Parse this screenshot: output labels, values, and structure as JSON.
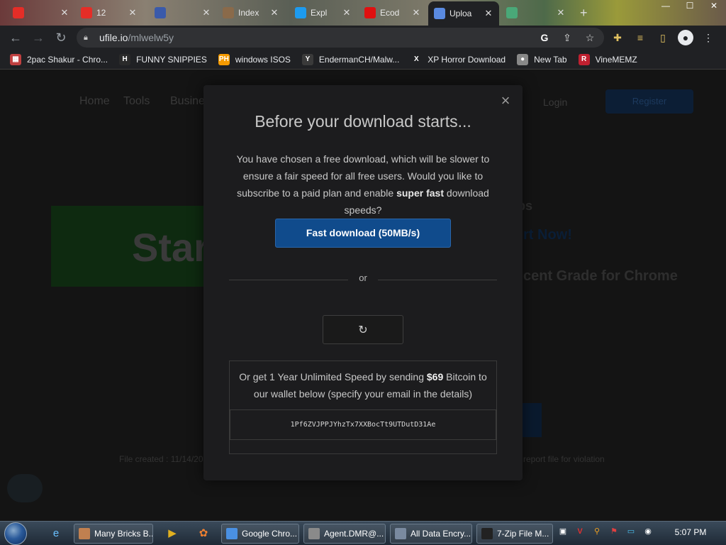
{
  "tabs": [
    {
      "title": "",
      "fav_color": "#e52d27",
      "active": false
    },
    {
      "title": "12",
      "fav_color": "#e52d27",
      "active": false
    },
    {
      "title": "",
      "fav_color": "#3a5aaa",
      "active": false
    },
    {
      "title": "Index",
      "fav_color": "#8a6a4a",
      "active": false
    },
    {
      "title": "Expl",
      "fav_color": "#1d9bf0",
      "active": false
    },
    {
      "title": "Ecod",
      "fav_color": "#e01010",
      "active": false
    },
    {
      "title": "Uploa",
      "fav_color": "#5a8ae0",
      "active": true
    },
    {
      "title": "",
      "fav_color": "#4aa878",
      "active": false
    }
  ],
  "window_controls": {
    "minimize": "—",
    "maximize": "☐",
    "close": "✕"
  },
  "address_bar": {
    "host": "ufile.io",
    "path": "/mlwelw5y"
  },
  "bookmarks": [
    {
      "label": "2pac Shakur - Chro...",
      "icon": "gift-icon",
      "icon_text": "▦",
      "color": "#c04040"
    },
    {
      "label": "FUNNY SNIPPIES",
      "icon": "h-icon",
      "icon_text": "H",
      "color": "#2a2a2a"
    },
    {
      "label": "windows ISOS",
      "icon": "ph-icon",
      "icon_text": "PH",
      "color": "#f59a00"
    },
    {
      "label": "EndermanCH/Malw...",
      "icon": "yp-icon",
      "icon_text": "Y",
      "color": "#3a3a3a"
    },
    {
      "label": "XP Horror Download",
      "icon": "x-icon",
      "icon_text": "X",
      "color": "#202124"
    },
    {
      "label": "New Tab",
      "icon": "ball-icon",
      "icon_text": "●",
      "color": "#888"
    },
    {
      "label": "VineMEMZ",
      "icon": "r-icon",
      "icon_text": "R",
      "color": "#c02030"
    }
  ],
  "page_bg": {
    "nav": [
      "Home",
      "Tools",
      "Business"
    ],
    "login": "Login",
    "register": "Register",
    "start_text": "Star",
    "right_text_1": "ps",
    "right_text_2": "rt Now!",
    "right_text_3": "cent Grade for Chrome",
    "footer_left": "File created : 11/14/20",
    "footer_right": "report file for violation"
  },
  "modal": {
    "close": "×",
    "title": "Before your download starts...",
    "desc_part1": "You have chosen a free download, which will be slower to ensure a fair speed for all free users. Would you like to subscribe to a paid plan and enable ",
    "desc_bold": "super fast",
    "desc_part2": " download speeds?",
    "fast_button": "Fast download (50MB/s)",
    "or": "or",
    "refresh_icon": "↻",
    "btc_part1": "Or get 1 Year Unlimited Speed by sending ",
    "btc_price": "$69",
    "btc_part2": " Bitcoin to our wallet below (specify your email in the details)",
    "wallet": "1Pf6ZVJPPJYhzTx7XXBocTt9UTDutD31Ae"
  },
  "taskbar": {
    "tasks": [
      {
        "label": "Many Bricks B...",
        "color": "#c08050"
      },
      {
        "label": "Google Chro...",
        "color": "#4a90e2"
      },
      {
        "label": "Agent.DMR@...",
        "color": "#8a8a8a"
      },
      {
        "label": "All Data Encry...",
        "color": "#7a8aa0"
      },
      {
        "label": "7-Zip File M...",
        "color": "#222"
      }
    ],
    "clock": "5:07 PM"
  }
}
